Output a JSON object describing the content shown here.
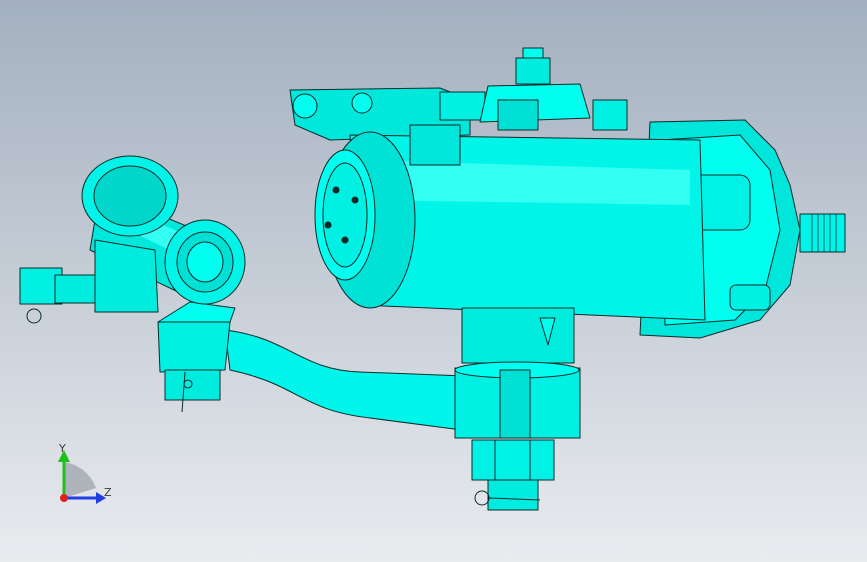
{
  "viewport": {
    "colors": {
      "background_top": "#a3b0bf",
      "background_bottom": "#e9ecef",
      "part_fill": "#00ffee",
      "part_fill_shade": "#00c9c0",
      "edge_line": "#0b2b2a"
    }
  },
  "model": {
    "components": [
      "steering-gear-housing",
      "input-shaft-spline",
      "steering-column-tube",
      "column-elbow-joint",
      "pitman-arm",
      "sector-shaft-nut",
      "ball-joint-stud",
      "cotter-pin"
    ]
  },
  "triad": {
    "y_label": "Y",
    "z_label": "Z",
    "y_color": "#1fbf1f",
    "z_color": "#1f3fe0",
    "x_color": "#e01f1f"
  }
}
